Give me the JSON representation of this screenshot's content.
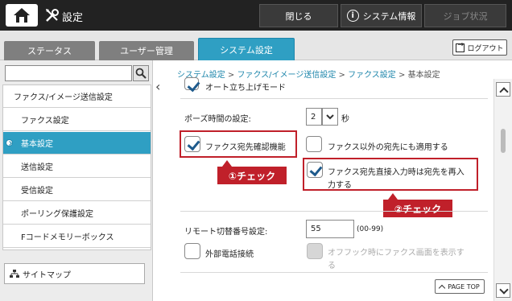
{
  "header": {
    "title": "設定",
    "buttons": {
      "close": "閉じる",
      "system_info": "システム情報",
      "job_status": "ジョブ状況"
    }
  },
  "tabs": [
    {
      "label": "ステータス",
      "active": false
    },
    {
      "label": "ユーザー管理",
      "active": false
    },
    {
      "label": "システム設定",
      "active": true
    }
  ],
  "logout_label": "ログアウト",
  "sidebar": {
    "search_placeholder": "",
    "items": [
      {
        "label": "ファクス/イメージ送信設定",
        "level": 0
      },
      {
        "label": "ファクス設定",
        "level": 1
      },
      {
        "label": "基本設定",
        "level": 1,
        "active": true
      },
      {
        "label": "送信設定",
        "level": 1
      },
      {
        "label": "受信設定",
        "level": 1
      },
      {
        "label": "ポーリング保護設定",
        "level": 1
      },
      {
        "label": "Fコードメモリーボックス",
        "level": 1
      }
    ],
    "sitemap_label": "サイトマップ"
  },
  "breadcrumb": {
    "items": [
      "システム設定",
      "ファクス/イメージ送信設定",
      "ファクス設定"
    ],
    "current": "基本設定",
    "separator": ">"
  },
  "settings": {
    "auto_start_mode": {
      "label": "オート立ち上げモード",
      "checked": true
    },
    "pause_time": {
      "label": "ポーズ時間の設定:",
      "value": "2",
      "unit": "秒"
    },
    "fax_confirm": {
      "label": "ファクス宛先確認機能",
      "checked": true
    },
    "apply_non_fax": {
      "label": "ファクス以外の宛先にも適用する",
      "checked": false
    },
    "re_enter": {
      "line1": "ファクス宛先直接入力時は宛先を再入",
      "line2": "力する",
      "checked": true
    },
    "remote_switch": {
      "label": "リモート切替番号設定:",
      "value": "55",
      "range": "(00-99)"
    },
    "external_phone": {
      "label": "外部電話接続",
      "checked": false
    },
    "offhook_display": {
      "line1": "オフフック時にファクス画面を表示す",
      "line2": "る",
      "checked": false,
      "disabled": true
    }
  },
  "annotations": {
    "callout1": "①チェック",
    "callout2": "②チェック"
  },
  "page_top_label": "PAGE TOP",
  "colors": {
    "accent": "#2f9fc3",
    "annotation_red": "#c0202a",
    "topbar": "#222222"
  }
}
